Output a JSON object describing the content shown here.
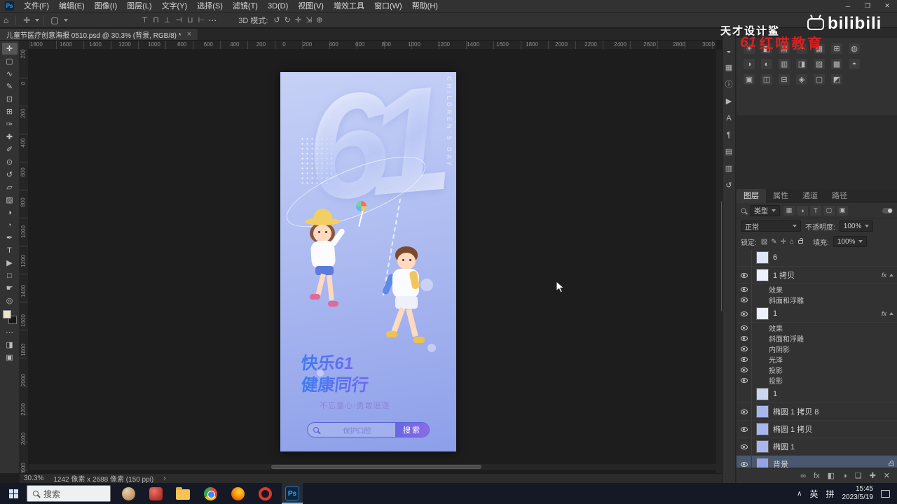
{
  "window": {
    "app_logo": "Ps",
    "controls": {
      "minimize": "─",
      "maximize": "❐",
      "close": "✕"
    }
  },
  "menu": {
    "items": [
      "文件(F)",
      "编辑(E)",
      "图像(I)",
      "图层(L)",
      "文字(Y)",
      "选择(S)",
      "滤镜(T)",
      "3D(D)",
      "视图(V)",
      "增效工具",
      "窗口(W)",
      "帮助(H)"
    ]
  },
  "options_bar": {
    "home_icon": "⌂",
    "tool_icon": "✛",
    "preset_icon": "▢",
    "align_icons": [
      "⊤",
      "⊓",
      "⊥",
      "⊣",
      "⊔",
      "⊢"
    ],
    "more_icon": "⋯",
    "mode_label": "3D 模式:",
    "mode_icons": [
      "↺",
      "↻",
      "✛",
      "⇲",
      "⊕"
    ]
  },
  "doc_tab": {
    "title": "儿童节医疗创意海报 0510.psd @ 30.3% (背景, RGB/8) *",
    "close": "×"
  },
  "rulers": {
    "horizontal": [
      "1800",
      "1600",
      "1400",
      "1200",
      "1000",
      "800",
      "600",
      "400",
      "200",
      "0",
      "200",
      "400",
      "600",
      "800",
      "1000",
      "1200",
      "1400",
      "1600",
      "1800",
      "2000",
      "2200",
      "2400",
      "2600",
      "2800",
      "3000"
    ],
    "vertical": [
      "200",
      "0",
      "200",
      "400",
      "600",
      "800",
      "1000",
      "1200",
      "1400",
      "1600",
      "1800",
      "2000",
      "2200",
      "2400",
      "2600"
    ]
  },
  "toolbar": {
    "tools": [
      {
        "icon": "move-tool",
        "glyph": "✛",
        "active": true
      },
      {
        "icon": "marquee-tool",
        "glyph": "▢"
      },
      {
        "icon": "lasso-tool",
        "glyph": "∿"
      },
      {
        "icon": "quick-selection-tool",
        "glyph": "✎"
      },
      {
        "icon": "crop-tool",
        "glyph": "⊡"
      },
      {
        "icon": "frame-tool",
        "glyph": "⊞"
      },
      {
        "icon": "eyedropper-tool",
        "glyph": "✑"
      },
      {
        "icon": "healing-brush-tool",
        "glyph": "✚"
      },
      {
        "icon": "brush-tool",
        "glyph": "✐"
      },
      {
        "icon": "clone-stamp-tool",
        "glyph": "⊙"
      },
      {
        "icon": "history-brush-tool",
        "glyph": "↺"
      },
      {
        "icon": "eraser-tool",
        "glyph": "▱"
      },
      {
        "icon": "gradient-tool",
        "glyph": "▨"
      },
      {
        "icon": "blur-tool",
        "glyph": "◑"
      },
      {
        "icon": "dodge-tool",
        "glyph": "◔"
      },
      {
        "icon": "pen-tool",
        "glyph": "✒"
      },
      {
        "icon": "type-tool",
        "glyph": "T"
      },
      {
        "icon": "path-selection-tool",
        "glyph": "▶"
      },
      {
        "icon": "shape-tool",
        "glyph": "□"
      },
      {
        "icon": "hand-tool",
        "glyph": "☛"
      },
      {
        "icon": "zoom-tool",
        "glyph": "◎"
      }
    ],
    "extras": [
      {
        "icon": "edit-toolbar-icon",
        "glyph": "⋯"
      },
      {
        "icon": "quick-mask-icon",
        "glyph": "◨"
      },
      {
        "icon": "screen-mode-icon",
        "glyph": "▣"
      }
    ],
    "foreground_color": "#ece6c8",
    "background_color": "#181818"
  },
  "canvas": {
    "poster": {
      "big_number": "61",
      "vertical_text": "CHILDREN'S DAY",
      "title_line1": "快乐61",
      "title_line2": "健康同行",
      "subtitle": "不忘童心·勇敢追逐",
      "search_text": "保护口腔",
      "search_button": "搜索"
    }
  },
  "status_bar": {
    "zoom": "30.3%",
    "doc_size": "1242 像素 x 2688 像素 (150 ppi)",
    "chevron": "›"
  },
  "dock": {
    "strip_icons": [
      {
        "icon": "collapse-panels-icon",
        "glyph": "«"
      },
      {
        "icon": "color-panel-icon",
        "glyph": "◒"
      },
      {
        "icon": "swatches-panel-icon",
        "glyph": "▦"
      },
      {
        "icon": "info-panel-icon",
        "glyph": "ⓘ"
      },
      {
        "icon": "actions-panel-icon",
        "glyph": "▶"
      },
      {
        "icon": "character-panel-icon",
        "glyph": "A"
      },
      {
        "icon": "paragraph-panel-icon",
        "glyph": "¶"
      },
      {
        "icon": "properties-panel-icon",
        "glyph": "▤"
      },
      {
        "icon": "libraries-panel-icon",
        "glyph": "▥"
      },
      {
        "icon": "history-panel-icon",
        "glyph": "↺"
      }
    ],
    "adjustments": {
      "row1": [
        "☀",
        "◧",
        "▤",
        "◔",
        "▦",
        "⊞",
        "◍"
      ],
      "row2": [
        "◑",
        "◐",
        "▥",
        "◨",
        "▧",
        "▩",
        "◓"
      ],
      "row3": [
        "▣",
        "◫",
        "⊟",
        "◈",
        "▢",
        "◩"
      ]
    }
  },
  "layers_panel": {
    "tabs": [
      {
        "label": "图层",
        "active": true
      },
      {
        "label": "属性"
      },
      {
        "label": "通道"
      },
      {
        "label": "路径"
      }
    ],
    "filter_label": "类型",
    "filter_icons": [
      "▦",
      "◑",
      "T",
      "▢",
      "▣"
    ],
    "blend_mode": "正常",
    "opacity_label": "不透明度:",
    "opacity_value": "100%",
    "lock_label": "锁定:",
    "lock_icons": [
      "▨",
      "✎",
      "✛",
      "⌂"
    ],
    "fill_label": "填充:",
    "fill_value": "100%",
    "fx_badge": "fx",
    "items": [
      {
        "name": "6",
        "kind": "layer",
        "thumb": "#dfe5f8"
      },
      {
        "name": "1 拷贝",
        "kind": "layer",
        "eye": true,
        "fx": true,
        "thumb": "#eef1fb"
      },
      {
        "name": "效果",
        "kind": "fx",
        "eye": true
      },
      {
        "name": "斜面和浮雕",
        "kind": "fx",
        "eye": true
      },
      {
        "name": "1",
        "kind": "layer",
        "eye": true,
        "fx": true,
        "thumb": "#eef1fb"
      },
      {
        "name": "效果",
        "kind": "fx",
        "eye": true
      },
      {
        "name": "斜面和浮雕",
        "kind": "fx",
        "eye": true
      },
      {
        "name": "内阴影",
        "kind": "fx",
        "eye": true
      },
      {
        "name": "光泽",
        "kind": "fx",
        "eye": true
      },
      {
        "name": "投影",
        "kind": "fx",
        "eye": true
      },
      {
        "name": "投影",
        "kind": "fx",
        "eye": true
      },
      {
        "name": "1",
        "kind": "layer",
        "thumb": "#ccd5f2"
      },
      {
        "name": "椭圆 1 拷贝 8",
        "kind": "layer",
        "eye": true,
        "thumb": "#a8b7ee"
      },
      {
        "name": "椭圆 1 拷贝",
        "kind": "layer",
        "eye": true,
        "thumb": "#a8b7ee"
      },
      {
        "name": "椭圆 1",
        "kind": "layer",
        "eye": true,
        "thumb": "#a8b7ee"
      },
      {
        "name": "背景",
        "kind": "layer",
        "eye": true,
        "selected": true,
        "locked": true,
        "thumb": "#93a5e8"
      }
    ],
    "bottom_icons": [
      {
        "icon": "link-layers-icon",
        "glyph": "∞"
      },
      {
        "icon": "layer-style-icon",
        "glyph": "fx"
      },
      {
        "icon": "layer-mask-icon",
        "glyph": "◧"
      },
      {
        "icon": "adjustment-layer-icon",
        "glyph": "◑"
      },
      {
        "icon": "new-group-icon",
        "glyph": "❏"
      },
      {
        "icon": "new-layer-icon",
        "glyph": "✚"
      },
      {
        "icon": "delete-layer-icon",
        "glyph": "✕"
      }
    ]
  },
  "watermarks": {
    "top_text": "天才设计鲨",
    "bilibili": "bilibili",
    "red_logo": "61",
    "red_text": "红喵教育"
  },
  "taskbar": {
    "search_placeholder": "搜索",
    "icons": [
      {
        "icon": "app-icon-1",
        "kind": "tbi-tan"
      },
      {
        "icon": "app-icon-2",
        "kind": "tbi-red"
      },
      {
        "icon": "file-explorer-icon",
        "kind": "tbi-folder"
      },
      {
        "icon": "chrome-icon",
        "kind": "tbi-chrome"
      },
      {
        "icon": "firefox-icon",
        "kind": "tbi-firefox"
      },
      {
        "icon": "opera-icon",
        "kind": "tbi-opera"
      },
      {
        "icon": "photoshop-icon",
        "kind": "tbi-ps",
        "label": "Ps",
        "active": true
      }
    ],
    "tray": {
      "caret": "∧",
      "lang1": "英",
      "lang2": "拼",
      "time": "15:45",
      "date": "2023/5/19"
    }
  }
}
